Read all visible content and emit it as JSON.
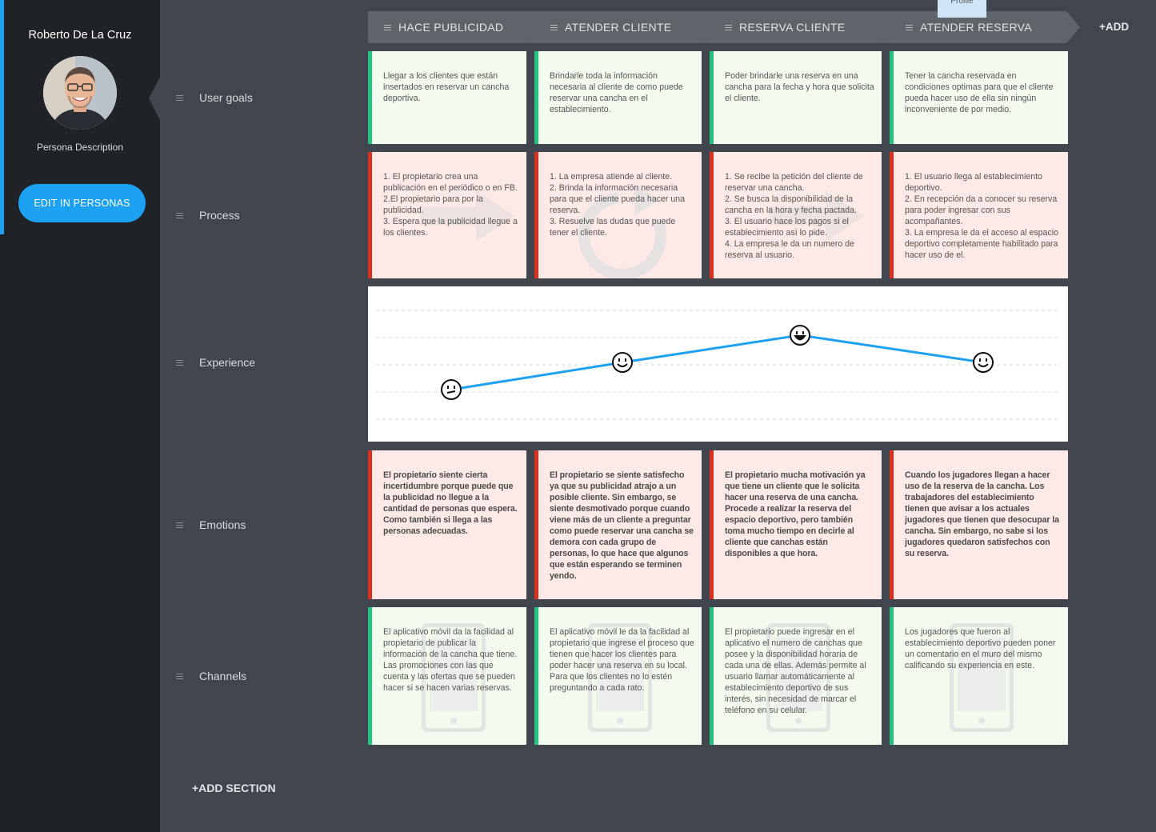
{
  "persona": {
    "name": "Roberto De La Cruz",
    "description": "Persona Description",
    "edit_button": "EDIT IN PERSONAS"
  },
  "stages": [
    "HACE PUBLICIDAD",
    "ATENDER CLIENTE",
    "RESERVA CLIENTE",
    "ATENDER RESERVA"
  ],
  "add_stage_label": "+ADD",
  "profile_tag": "Profile",
  "rows": {
    "user_goals": {
      "label": "User goals",
      "cards": [
        "Llegar a los clientes que están insertados en reservar un cancha deportiva.",
        "Brindarle toda la información necesaria al cliente de como puede reservar una cancha en el establecimiento.",
        "Poder brindarle una reserva en una cancha para la fecha y hora que solicita el cliente.",
        "Tener la cancha reservada en condiciones optimas para que el cliente pueda hacer uso de ella sin ningún inconveniente de por medio."
      ]
    },
    "process": {
      "label": "Process",
      "cards": [
        "1. El propietario crea una publicación en el periódico o en FB.\n2.El propietario para por la publicidad.\n3. Espera que la publicidad llegue a los clientes.",
        "1. La empresa atiende al cliente.\n2. Brinda la información necesaria para que el cliente pueda hacer una reserva.\n3. Resuelve las dudas que puede tener el cliente.",
        "1. Se recibe la petición del cliente de reservar una cancha.\n2. Se busca la disponibilidad de la cancha en la hora y fecha pactada.\n3. El usuario hace los pagos si el establecimiento así lo pide.\n4. La empresa le da un numero de reserva al usuario.",
        "1. El usuario llega al establecimiento deportivo.\n2. En recepción da a conocer su reserva para poder ingresar con sus acompañantes.\n3. La empresa le da el acceso al espacio deportivo completamente habilitado para hacer uso de el."
      ]
    },
    "experience": {
      "label": "Experience",
      "points": [
        {
          "stage": "HACE PUBLICIDAD",
          "level": 2,
          "face": "unsure-face-icon"
        },
        {
          "stage": "ATENDER CLIENTE",
          "level": 3,
          "face": "smile-face-icon"
        },
        {
          "stage": "RESERVA CLIENTE",
          "level": 4,
          "face": "laugh-face-icon"
        },
        {
          "stage": "ATENDER RESERVA",
          "level": 3,
          "face": "smile-face-icon"
        }
      ],
      "line_color": "#1da1f2"
    },
    "emotions": {
      "label": "Emotions",
      "cards": [
        "El propietario siente cierta incertidumbre porque puede que la publicidad no llegue a la cantidad de personas que espera. Como también si llega a las personas adecuadas.",
        "El propietario se siente satisfecho ya que su publicidad atrajo a un posible cliente. Sin embargo, se siente desmotivado porque cuando viene más de un cliente a preguntar como puede reservar una cancha se demora con cada grupo de personas, lo que hace que algunos que están esperando se terminen yendo.",
        "El propietario mucha motivación ya que tiene un cliente que le solicita hacer una reserva de una cancha. Procede a realizar la reserva del espacio deportivo, pero también toma mucho tiempo en decirle al cliente que canchas están disponibles a que hora.",
        "Cuando los jugadores llegan a hacer uso de la reserva de la cancha. Los trabajadores del establecimiento tienen que avisar a los actuales jugadores que tienen que desocupar la cancha. Sin embargo, no sabe si los jugadores quedaron satisfechos con su reserva."
      ]
    },
    "channels": {
      "label": "Channels",
      "cards": [
        "El aplicativo móvil da la facilidad al propietario de publicar la información de la cancha que tiene. Las promociones con las que cuenta y las ofertas que se pueden hacer si se hacen varias reservas.",
        "El aplicativo móvil le da la facilidad al propietario que ingrese el proceso que tienen que hacer los clientes para poder hacer una reserva en su local. Para que los clientes no lo estén preguntando a cada rato.",
        "El propietario puede ingresar en el aplicativo el numero de canchas que posee y la disponibilidad horaria de cada una de ellas. Además permite al usuario llamar automáticamente al establecimiento deportivo de sus interés, sin necesidad de marcar el teléfono en su celular.",
        "Los jugadores que fueron al establecimiento deportivo pueden poner un comentario en el muro del mismo calificando su experiencia en este."
      ]
    }
  },
  "add_section_label": "+ADD SECTION",
  "colors": {
    "accent": "#1da1f2",
    "positive_border": "#26c281",
    "negative_border": "#d9301f",
    "positive_bg": "#f3fbee",
    "negative_bg": "#fde9e5"
  }
}
